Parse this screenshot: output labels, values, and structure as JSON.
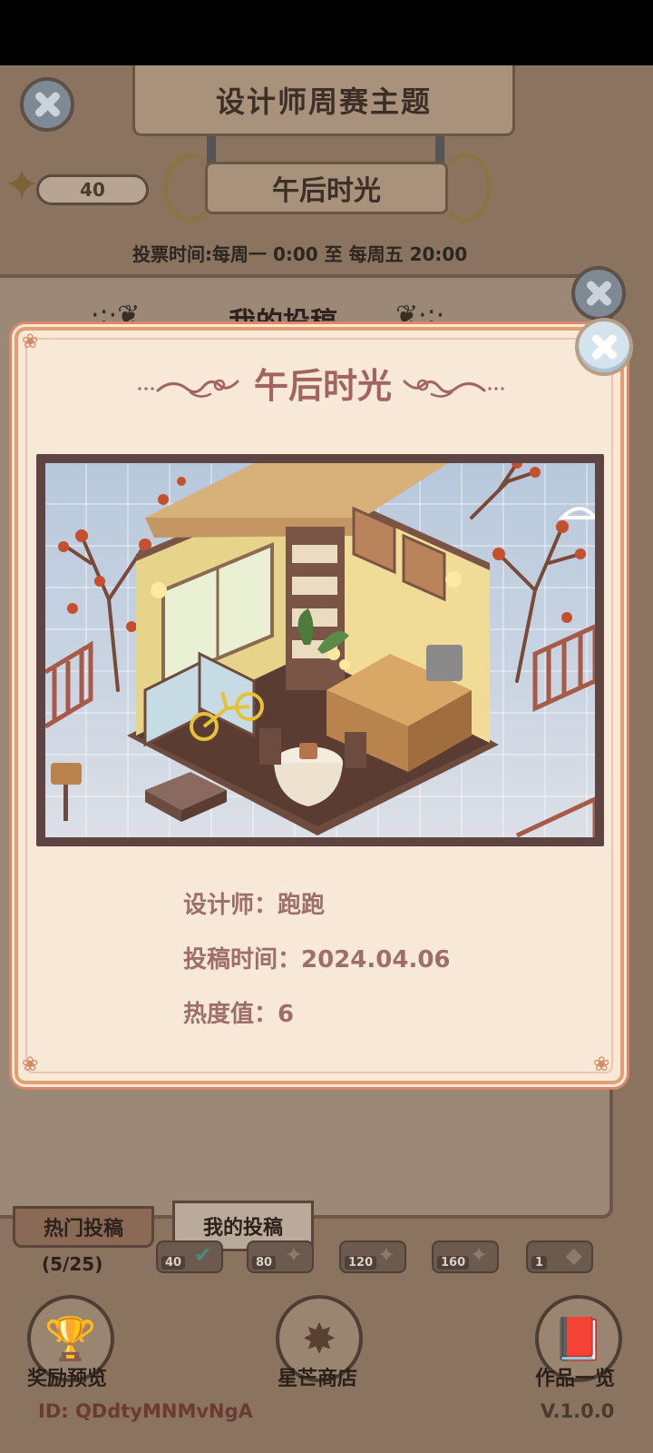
{
  "background": {
    "header_title": "设计师周赛主题",
    "theme_name": "午后时光",
    "star_count": "40",
    "vote_time": "投票时间:每周一  0:00  至  每周五  20:00",
    "panel_title": "我的投稿",
    "tabs": [
      {
        "label": "热门投稿"
      },
      {
        "label": "我的投稿"
      }
    ],
    "progress": "(5/25)",
    "rewards": [
      {
        "value": "40"
      },
      {
        "value": "80"
      },
      {
        "value": "120"
      },
      {
        "value": "160"
      },
      {
        "value": "1"
      }
    ],
    "bottom_buttons": [
      {
        "label": "奖励预览",
        "icon": "trophy-icon"
      },
      {
        "label": "星芒商店",
        "icon": "star-icon"
      },
      {
        "label": "作品一览",
        "icon": "book-icon"
      }
    ],
    "player_id": "ID: QDdtyMNMvNgA",
    "version": "V.1.0.0"
  },
  "modal": {
    "title": "午后时光",
    "image_alt": "午后时光",
    "designer_label": "设计师：",
    "designer_value": "跑跑",
    "submit_time_label": "投稿时间：",
    "submit_time_value": "2024.04.06",
    "heat_label": "热度值：",
    "heat_value": "6"
  },
  "colors": {
    "modal_bg": "#f8e8d8",
    "modal_border": "#e39f72",
    "title_text": "#a2645f",
    "detail_text": "#9e6f68",
    "frame": "#5e4443"
  }
}
